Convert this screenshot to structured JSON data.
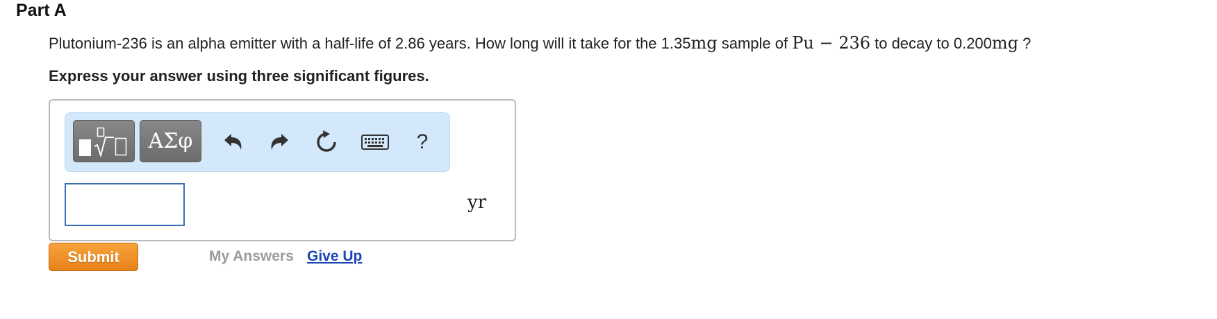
{
  "part": {
    "title": "Part A"
  },
  "question": {
    "text_before": "Plutonium-236 is an alpha emitter with a half-life of 2.86 years. How long will it take for the 1.35",
    "unit_mg_1": "mg",
    "text_mid": " sample of ",
    "isotope": "Pu − 236",
    "text_after": " to decay to 0.200",
    "unit_mg_2": "mg",
    "question_mark": " ?"
  },
  "instruction": "Express your answer using three significant figures.",
  "toolbar": {
    "templates_icon": "templates-icon",
    "greek_label": "ΑΣφ",
    "undo_icon": "undo-icon",
    "redo_icon": "redo-icon",
    "reset_icon": "reset-icon",
    "keyboard_icon": "keyboard-icon",
    "help_label": "?"
  },
  "answer": {
    "value": "",
    "unit": "yr"
  },
  "actions": {
    "submit_label": "Submit",
    "my_answers_label": "My Answers",
    "give_up_label": "Give Up"
  },
  "colors": {
    "toolbar_bg": "#d4e8fb",
    "submit_bg": "#f0922a",
    "give_up_link": "#1b46b5",
    "input_border": "#3a6fb6"
  }
}
